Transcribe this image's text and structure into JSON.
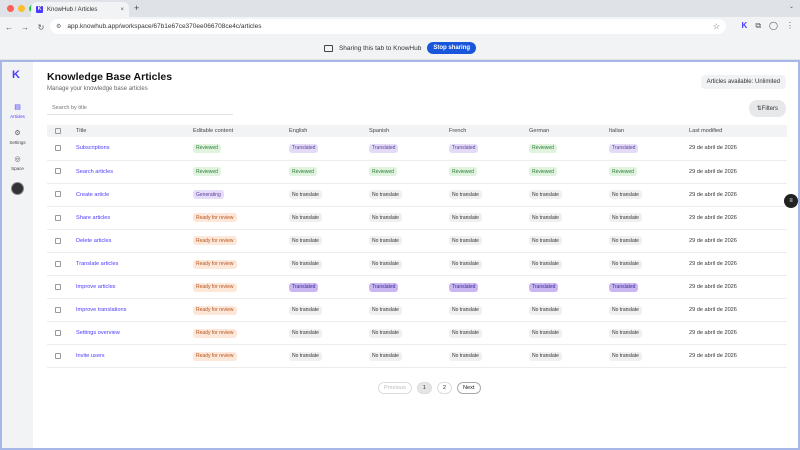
{
  "browser": {
    "tab_title": "KnowHub / Articles",
    "tab_close": "×",
    "new_tab": "+",
    "url": "app.knowhub.app/workspace/67b1e67ce370ee066708ce4c/articles"
  },
  "sharebar": {
    "text": "Sharing this tab to KnowHub",
    "button": "Stop sharing"
  },
  "sidebar": {
    "items": [
      {
        "label": "Articles",
        "icon": "book-icon"
      },
      {
        "label": "Settings",
        "icon": "gear-icon"
      },
      {
        "label": "Space",
        "icon": "compass-icon"
      }
    ]
  },
  "header": {
    "title": "Knowledge Base Articles",
    "subtitle": "Manage your knowledge base articles",
    "availability": "Articles available: Unlimited",
    "search_placeholder": "Search by title",
    "filters": "Filters"
  },
  "table": {
    "columns": [
      "Title",
      "Editable content",
      "English",
      "Spanish",
      "French",
      "German",
      "Italian",
      "Last modified"
    ],
    "rows": [
      {
        "title": "Subscriptions",
        "editable": "Reviewed",
        "en": "Translated",
        "es": "Translated",
        "fr": "Translated",
        "de": "Reviewed",
        "it": "Translated",
        "modified": "29 de abril de 2026"
      },
      {
        "title": "Search articles",
        "editable": "Reviewed",
        "en": "Reviewed",
        "es": "Reviewed",
        "fr": "Reviewed",
        "de": "Reviewed",
        "it": "Reviewed",
        "modified": "29 de abril de 2026"
      },
      {
        "title": "Create article",
        "editable": "Generating",
        "en": "No translate",
        "es": "No translate",
        "fr": "No translate",
        "de": "No translate",
        "it": "No translate",
        "modified": "29 de abril de 2026"
      },
      {
        "title": "Share articles",
        "editable": "Ready for review",
        "en": "No translate",
        "es": "No translate",
        "fr": "No translate",
        "de": "No translate",
        "it": "No translate",
        "modified": "29 de abril de 2026"
      },
      {
        "title": "Delete articles",
        "editable": "Ready for review",
        "en": "No translate",
        "es": "No translate",
        "fr": "No translate",
        "de": "No translate",
        "it": "No translate",
        "modified": "29 de abril de 2026"
      },
      {
        "title": "Translate articles",
        "editable": "Ready for review",
        "en": "No translate",
        "es": "No translate",
        "fr": "No translate",
        "de": "No translate",
        "it": "No translate",
        "modified": "29 de abril de 2026"
      },
      {
        "title": "Improve articles",
        "editable": "Ready for review",
        "en": "Translated",
        "es": "Translated",
        "fr": "Translated",
        "de": "Translated",
        "it": "Translated",
        "modified": "29 de abril de 2026"
      },
      {
        "title": "Improve translations",
        "editable": "Ready for review",
        "en": "No translate",
        "es": "No translate",
        "fr": "No translate",
        "de": "No translate",
        "it": "No translate",
        "modified": "29 de abril de 2026"
      },
      {
        "title": "Settings overview",
        "editable": "Ready for review",
        "en": "No translate",
        "es": "No translate",
        "fr": "No translate",
        "de": "No translate",
        "it": "No translate",
        "modified": "29 de abril de 2026"
      },
      {
        "title": "Invite users",
        "editable": "Ready for review",
        "en": "No translate",
        "es": "No translate",
        "fr": "No translate",
        "de": "No translate",
        "it": "No translate",
        "modified": "29 de abril de 2026"
      }
    ]
  },
  "pagination": {
    "previous": "Previous",
    "pages": [
      "1",
      "2"
    ],
    "current": "1",
    "next": "Next"
  }
}
